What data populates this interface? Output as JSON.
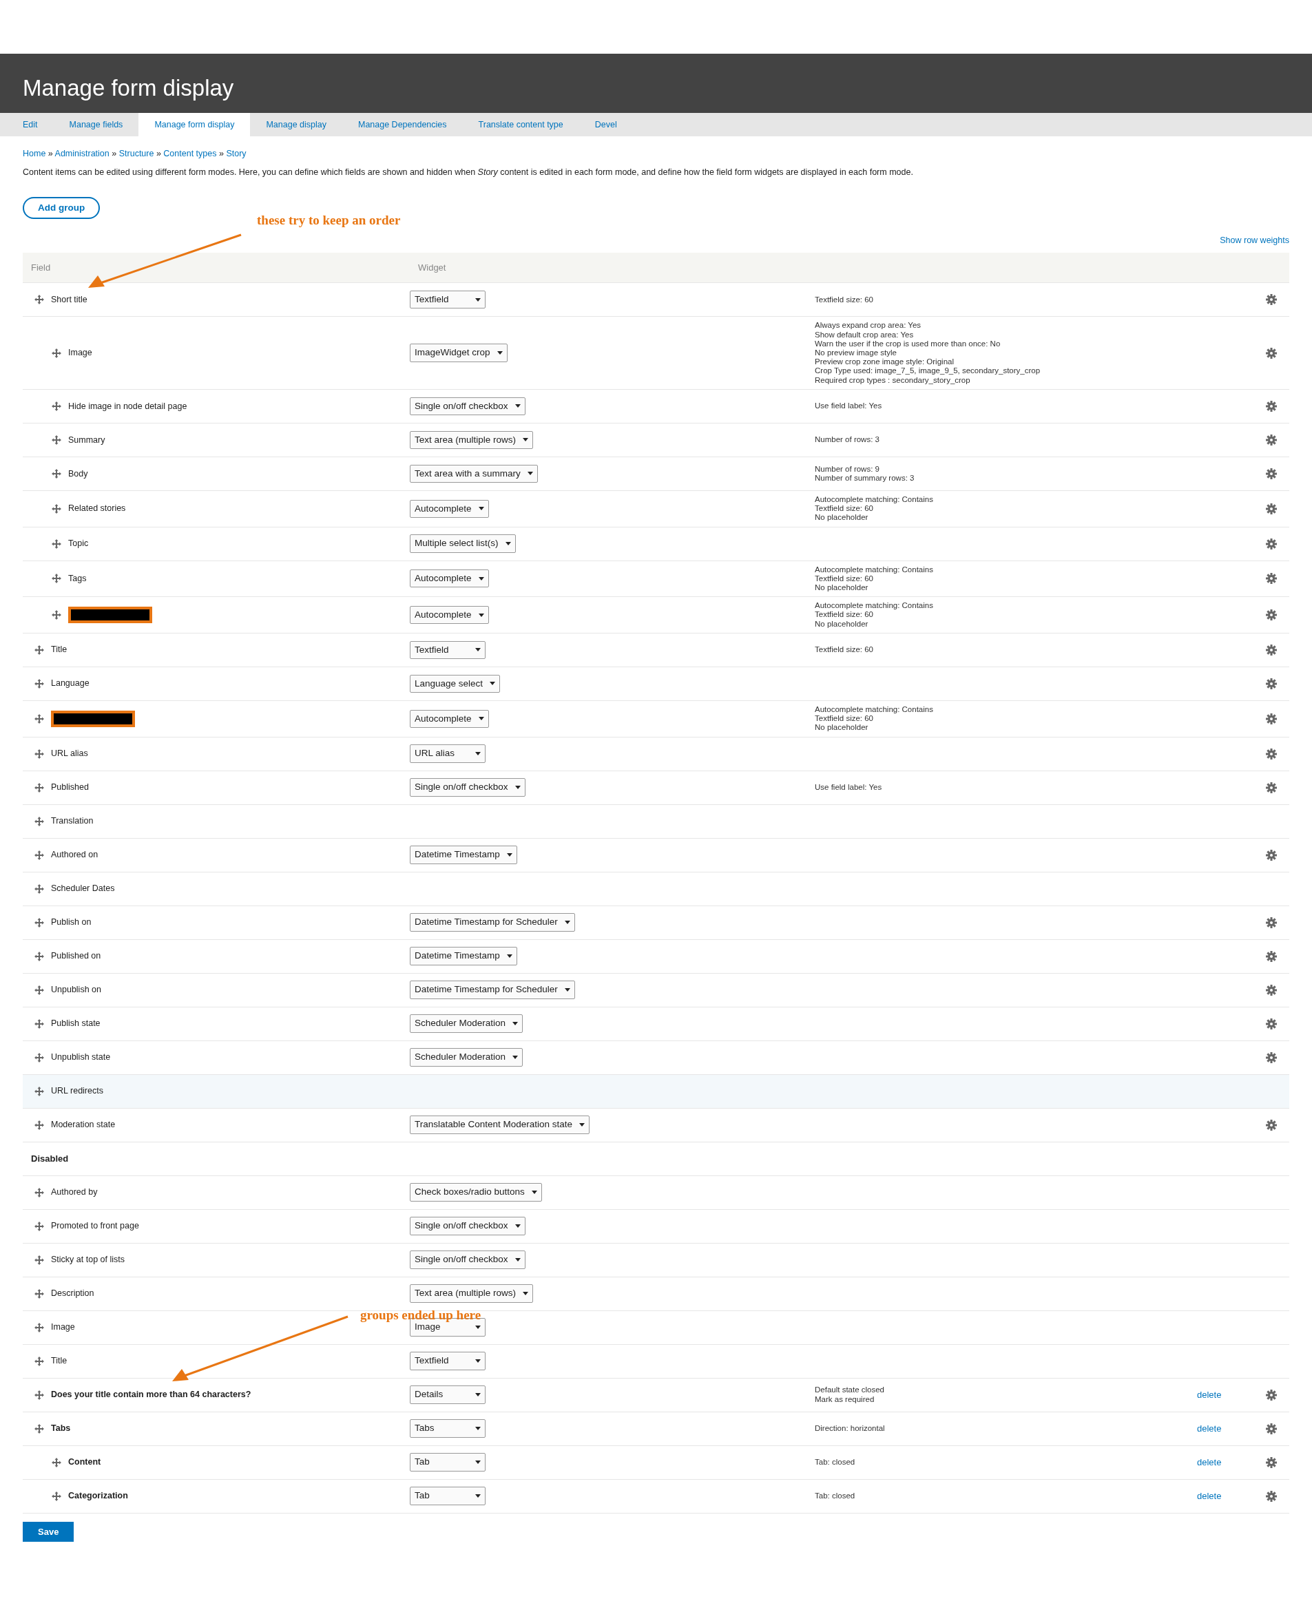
{
  "page": {
    "title": "Manage form display"
  },
  "tabs": [
    {
      "label": "Edit",
      "selected": false
    },
    {
      "label": "Manage fields",
      "selected": false
    },
    {
      "label": "Manage form display",
      "selected": true
    },
    {
      "label": "Manage display",
      "selected": false
    },
    {
      "label": "Manage Dependencies",
      "selected": false
    },
    {
      "label": "Translate content type",
      "selected": false
    },
    {
      "label": "Devel",
      "selected": false
    }
  ],
  "breadcrumb": {
    "separator": "»",
    "items": [
      "Home",
      "Administration",
      "Structure",
      "Content types",
      "Story"
    ]
  },
  "description": "Content items can be edited using different form modes. Here, you can define which fields are shown and hidden when *Story* content is edited in each form mode, and define how the field form widgets are displayed in each form mode.",
  "add_group_button": "Add group",
  "show_row_weights": "Show row weights",
  "table": {
    "columns": [
      "Field",
      "Widget"
    ],
    "rows": [
      {
        "kind": "field",
        "field": "Short title",
        "widget": "Textfield",
        "summary": [
          "Textfield size: 60"
        ],
        "settings": true,
        "children": [
          {
            "kind": "field",
            "field": "Image",
            "widget": "ImageWidget crop",
            "summary": [
              "Always expand crop area: Yes",
              "Show default crop area: Yes",
              "Warn the user if the crop is used more than once: No",
              "No preview image style",
              "Preview crop zone image style: Original",
              "Crop Type used: image_7_5, image_9_5, secondary_story_crop",
              "Required crop types : secondary_story_crop"
            ],
            "settings": true
          },
          {
            "kind": "field",
            "field": "Hide image in node detail page",
            "widget": "Single on/off checkbox",
            "summary": [
              "Use field label: Yes"
            ],
            "settings": true
          },
          {
            "kind": "field",
            "field": "Summary",
            "widget": "Text area (multiple rows)",
            "summary": [
              "Number of rows: 3"
            ],
            "settings": true
          },
          {
            "kind": "field",
            "field": "Body",
            "widget": "Text area with a summary",
            "summary": [
              "Number of rows: 9",
              "Number of summary rows: 3"
            ],
            "settings": true
          },
          {
            "kind": "field",
            "field": "Related stories",
            "widget": "Autocomplete",
            "summary": [
              "Autocomplete matching: Contains",
              "Textfield size: 60",
              "No placeholder"
            ],
            "settings": true
          },
          {
            "kind": "field",
            "field": "Topic",
            "widget": "Multiple select list(s)",
            "settings": true
          },
          {
            "kind": "field",
            "field": "Tags",
            "widget": "Autocomplete",
            "summary": [
              "Autocomplete matching: Contains",
              "Textfield size: 60",
              "No placeholder"
            ],
            "settings": true
          },
          {
            "kind": "redacted",
            "widget": "Autocomplete",
            "summary": [
              "Autocomplete matching: Contains",
              "Textfield size: 60",
              "No placeholder"
            ],
            "settings": true
          }
        ]
      },
      {
        "kind": "field",
        "field": "Title",
        "widget": "Textfield",
        "summary": [
          "Textfield size: 60"
        ],
        "settings": true
      },
      {
        "kind": "field",
        "field": "Language",
        "widget": "Language select",
        "settings": true
      },
      {
        "kind": "redacted",
        "widget": "Autocomplete",
        "summary": [
          "Autocomplete matching: Contains",
          "Textfield size: 60",
          "No placeholder"
        ],
        "settings": true
      },
      {
        "kind": "field",
        "field": "URL alias",
        "widget": "URL alias",
        "settings": true
      },
      {
        "kind": "field",
        "field": "Published",
        "widget": "Single on/off checkbox",
        "summary": [
          "Use field label: Yes"
        ],
        "settings": true
      },
      {
        "kind": "field",
        "field": "Translation",
        "settings": false
      },
      {
        "kind": "field",
        "field": "Authored on",
        "widget": "Datetime Timestamp",
        "settings": true
      },
      {
        "kind": "field",
        "field": "Scheduler Dates",
        "settings": false
      },
      {
        "kind": "field",
        "field": "Publish on",
        "widget": "Datetime Timestamp for Scheduler",
        "settings": true
      },
      {
        "kind": "field",
        "field": "Published on",
        "widget": "Datetime Timestamp",
        "settings": true
      },
      {
        "kind": "field",
        "field": "Unpublish on",
        "widget": "Datetime Timestamp for Scheduler",
        "settings": true
      },
      {
        "kind": "field",
        "field": "Publish state",
        "widget": "Scheduler Moderation",
        "settings": true
      },
      {
        "kind": "field",
        "field": "Unpublish state",
        "widget": "Scheduler Moderation",
        "settings": true
      },
      {
        "kind": "field",
        "field": "URL redirects",
        "settings": false,
        "highlighted": true
      },
      {
        "kind": "field",
        "field": "Moderation state",
        "widget": "Translatable Content Moderation state",
        "settings": true
      },
      {
        "kind": "region",
        "field": "Disabled"
      },
      {
        "kind": "field",
        "field": "Authored by",
        "widget": "Check boxes/radio buttons",
        "settings": false
      },
      {
        "kind": "field",
        "field": "Promoted to front page",
        "widget": "Single on/off checkbox",
        "settings": false
      },
      {
        "kind": "field",
        "field": "Sticky at top of lists",
        "widget": "Single on/off checkbox",
        "settings": false
      },
      {
        "kind": "field",
        "field": "Description",
        "widget": "Text area (multiple rows)",
        "settings": false
      },
      {
        "kind": "field",
        "field": "Image",
        "widget": "Image",
        "settings": false
      },
      {
        "kind": "field",
        "field": "Title",
        "widget": "Textfield",
        "settings": false
      },
      {
        "kind": "group",
        "field": "Does your title contain more than 64 characters?",
        "widget": "Details",
        "summary": [
          "Default state closed",
          "Mark as required"
        ],
        "delete": "delete",
        "settings": true
      },
      {
        "kind": "group",
        "field": "Tabs",
        "widget": "Tabs",
        "summary": [
          "Direction: horizontal"
        ],
        "delete": "delete",
        "settings": true,
        "children": [
          {
            "kind": "group",
            "field": "Content",
            "widget": "Tab",
            "summary": [
              "Tab: closed"
            ],
            "delete": "delete",
            "settings": true
          },
          {
            "kind": "group",
            "field": "Categorization",
            "widget": "Tab",
            "summary": [
              "Tab: closed"
            ],
            "delete": "delete",
            "settings": true
          }
        ]
      }
    ]
  },
  "save_button": "Save",
  "annotations": [
    {
      "text": "these try to keep an order"
    },
    {
      "text": "groups ended up here"
    }
  ]
}
